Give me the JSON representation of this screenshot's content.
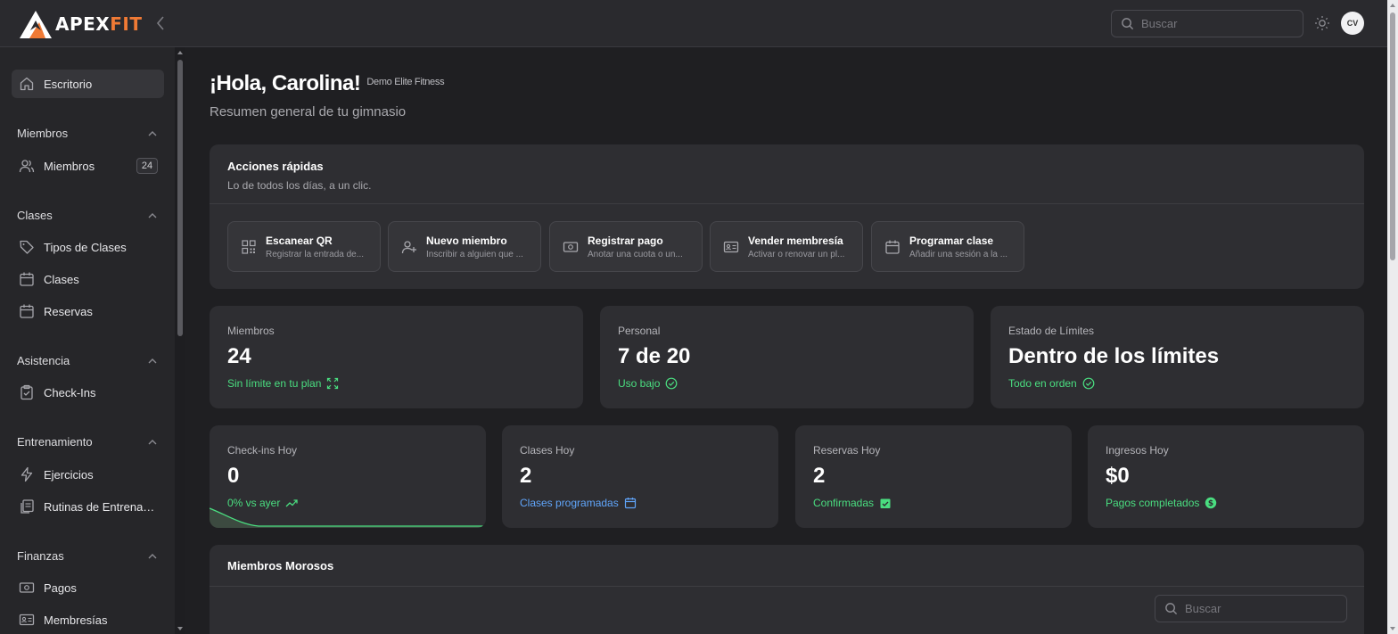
{
  "app": {
    "logo_part1": "APEX",
    "logo_part2": "FIT",
    "brand_color": "#f07a35"
  },
  "header": {
    "search_placeholder": "Buscar",
    "avatar_initials": "CV",
    "theme_icon": "sun-icon"
  },
  "sidebar": {
    "active_item": {
      "label": "Escritorio",
      "icon": "home-icon"
    },
    "sections": [
      {
        "title": "Miembros",
        "items": [
          {
            "label": "Miembros",
            "icon": "users-icon",
            "badge": "24"
          }
        ]
      },
      {
        "title": "Clases",
        "items": [
          {
            "label": "Tipos de Clases",
            "icon": "tag-icon"
          },
          {
            "label": "Clases",
            "icon": "calendar-icon"
          },
          {
            "label": "Reservas",
            "icon": "calendar-icon"
          }
        ]
      },
      {
        "title": "Asistencia",
        "items": [
          {
            "label": "Check-Ins",
            "icon": "clipboard-check-icon"
          }
        ]
      },
      {
        "title": "Entrenamiento",
        "items": [
          {
            "label": "Ejercicios",
            "icon": "bolt-icon"
          },
          {
            "label": "Rutinas de Entrenami...",
            "icon": "document-stack-icon"
          }
        ]
      },
      {
        "title": "Finanzas",
        "items": [
          {
            "label": "Pagos",
            "icon": "cash-icon"
          },
          {
            "label": "Membresías",
            "icon": "id-card-icon"
          }
        ]
      }
    ]
  },
  "greeting": {
    "title": "¡Hola, Carolina!",
    "gym_name": "Demo Elite Fitness",
    "subtitle": "Resumen general de tu gimnasio"
  },
  "quick_actions": {
    "title": "Acciones rápidas",
    "subtitle": "Lo de todos los días, a un clic.",
    "items": [
      {
        "title": "Escanear QR",
        "desc": "Registrar la entrada de...",
        "icon": "qr-code-icon"
      },
      {
        "title": "Nuevo miembro",
        "desc": "Inscribir a alguien que ...",
        "icon": "user-plus-icon"
      },
      {
        "title": "Registrar pago",
        "desc": "Anotar una cuota o un...",
        "icon": "cash-icon"
      },
      {
        "title": "Vender membresía",
        "desc": "Activar o renovar un pl...",
        "icon": "id-card-icon"
      },
      {
        "title": "Programar clase",
        "desc": "Añadir una sesión a la ...",
        "icon": "calendar-icon"
      }
    ]
  },
  "stats_top": [
    {
      "label": "Miembros",
      "value": "24",
      "note": "Sin límite en tu plan",
      "icon": "expand-icon",
      "color": "#4ade80"
    },
    {
      "label": "Personal",
      "value": "7 de 20",
      "note": "Uso bajo",
      "icon": "check-circle-icon",
      "color": "#4ade80"
    },
    {
      "label": "Estado de Límites",
      "value": "Dentro de los límites",
      "note": "Todo en orden",
      "icon": "check-circle-icon",
      "color": "#4ade80"
    }
  ],
  "stats_today": [
    {
      "label": "Check-ins Hoy",
      "value": "0",
      "note": "0% vs ayer",
      "icon": "trending-up-icon",
      "color": "#4ade80"
    },
    {
      "label": "Clases Hoy",
      "value": "2",
      "note": "Clases programadas",
      "icon": "calendar-icon",
      "color": "#60a5fa"
    },
    {
      "label": "Reservas Hoy",
      "value": "2",
      "note": "Confirmadas",
      "icon": "calendar-check-icon",
      "color": "#4ade80"
    },
    {
      "label": "Ingresos Hoy",
      "value": "$0",
      "note": "Pagos completados",
      "icon": "dollar-circle-icon",
      "color": "#4ade80"
    }
  ],
  "overdue_members": {
    "title": "Miembros Morosos",
    "search_placeholder": "Buscar"
  }
}
